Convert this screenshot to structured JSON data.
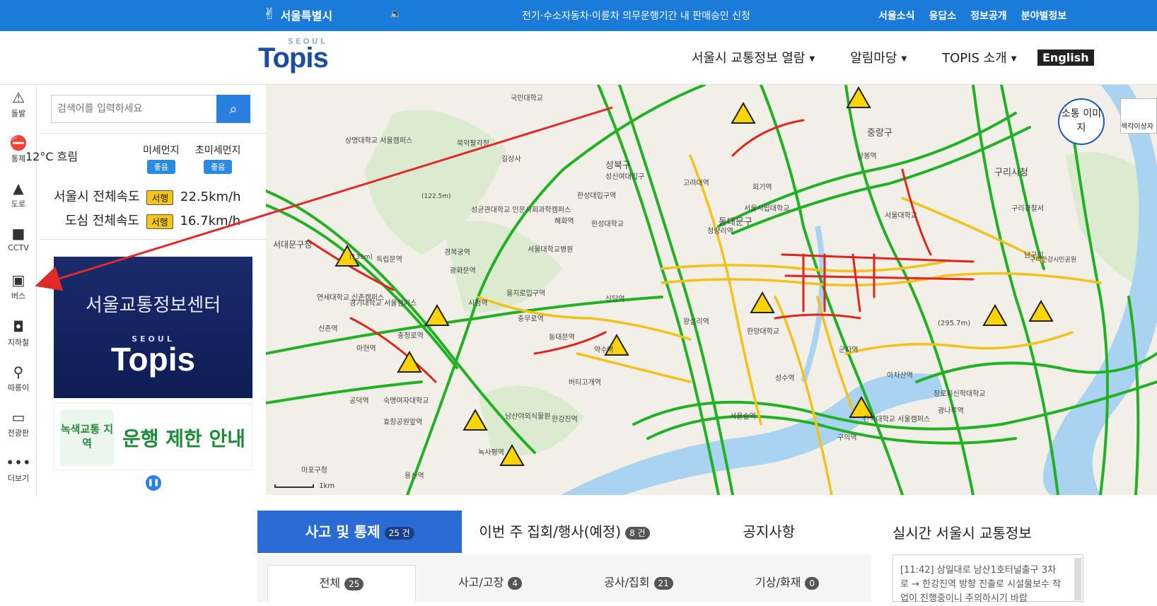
{
  "topbar": {
    "city_name": "서울특별시",
    "notice": "전기·수소자동차·이륜차 의무운행기간 내 판매승인 신청",
    "links": [
      "서울소식",
      "응답소",
      "정보공개",
      "분야별정보"
    ]
  },
  "header": {
    "logo_small": "SEOUL",
    "logo_big": "Topis",
    "nav": [
      "서울시 교통정보 열람",
      "알림마당",
      "TOPIS 소개"
    ],
    "english": "English"
  },
  "sidebar": {
    "items": [
      {
        "label": "돌발",
        "icon": "alarm-icon"
      },
      {
        "label": "통제",
        "icon": "no-entry-icon"
      },
      {
        "label": "도로",
        "icon": "road-icon"
      },
      {
        "label": "CCTV",
        "icon": "camera-icon"
      },
      {
        "label": "버스",
        "icon": "bus-icon"
      },
      {
        "label": "지하철",
        "icon": "subway-icon"
      },
      {
        "label": "따릉이",
        "icon": "bicycle-icon"
      },
      {
        "label": "전광판",
        "icon": "signboard-icon"
      },
      {
        "label": "더보기",
        "icon": "more-icon"
      }
    ]
  },
  "panel": {
    "search_placeholder": "검색어를 입력하세요",
    "weather": "12°C 흐림",
    "fine_dust": {
      "label": "미세먼지",
      "status": "좋음"
    },
    "ultra_fine_dust": {
      "label": "초미세먼지",
      "status": "좋음"
    },
    "speed_city": {
      "label": "서울시 전체속도",
      "status": "서행",
      "value": "22.5km/h"
    },
    "speed_downtown": {
      "label": "도심 전체속도",
      "status": "서행",
      "value": "16.7km/h"
    },
    "banner1": {
      "title": "서울교통정보센터",
      "logo_small": "SEOUL",
      "logo_big": "Topis"
    },
    "banner2": {
      "zone": "녹색교통 지역",
      "text": "운행 제한 안내"
    }
  },
  "map": {
    "sotong_button": "소통 이미지",
    "satellite_button": "색각이상자",
    "scale": "1km",
    "places": [
      "상명대학교 서울캠퍼스",
      "북악팔각정",
      "길상사",
      "국민대학교",
      "성북구",
      "성신여대입구",
      "한성대입구역",
      "성균관대학교 인문사회과학캠퍼스",
      "한성대학교",
      "서울대학교병원",
      "혜화역",
      "경복궁역",
      "광화문역",
      "시청역",
      "을지로입구역",
      "충무로역",
      "동대문역",
      "신당역",
      "약수역",
      "버티고개역",
      "남산야외식물원",
      "한강진역",
      "녹사평역",
      "용산역",
      "숙명여자대학교",
      "효창공원앞역",
      "공덕역",
      "마포구청",
      "서대문구청",
      "독립문역",
      "연세대학교 신촌캠퍼스",
      "경기대학교 서울캠퍼스",
      "충정로역",
      "아현역",
      "신촌역",
      "동대문구",
      "청량리역",
      "회기역",
      "서울시립대학교",
      "고려대역",
      "상봉역",
      "중랑구",
      "서울대학교",
      "구리시청",
      "구리경찰서",
      "왕십리역",
      "한양대학교",
      "성수역",
      "건국대학교 서울캠퍼스",
      "군자역",
      "아차산역",
      "장로회신학대학교",
      "광나루역",
      "구의역",
      "서울숲역",
      "남구리",
      "구리한강시민공원",
      "(295.7m)",
      "(139m)",
      "(122.5m)"
    ]
  },
  "bottom": {
    "tabs": [
      {
        "label": "사고 및 통제",
        "count": "25 건"
      },
      {
        "label": "이번 주 집회/행사(예정)",
        "count": "8 건"
      },
      {
        "label": "공지사항",
        "count": ""
      }
    ],
    "live_title": "실시간 서울시 교통정보",
    "subtabs": [
      {
        "label": "전체",
        "count": "25"
      },
      {
        "label": "사고/고장",
        "count": "4"
      },
      {
        "label": "공사/집회",
        "count": "21"
      },
      {
        "label": "기상/화재",
        "count": "0"
      }
    ],
    "live_text": "[11:42] 삼일대로 남산1호터널출구 3차로 → 한강진역 방향 진출로 시설물보수 작업이 진행중이니 주의하시기 바랍"
  },
  "colors": {
    "topbar": "#1a7bd8",
    "active_tab": "#2a6bd6",
    "road_free": "#22b024",
    "road_slow": "#f2c21b",
    "road_jam": "#e0251e",
    "annotation_arrow": "#e02a2a"
  }
}
